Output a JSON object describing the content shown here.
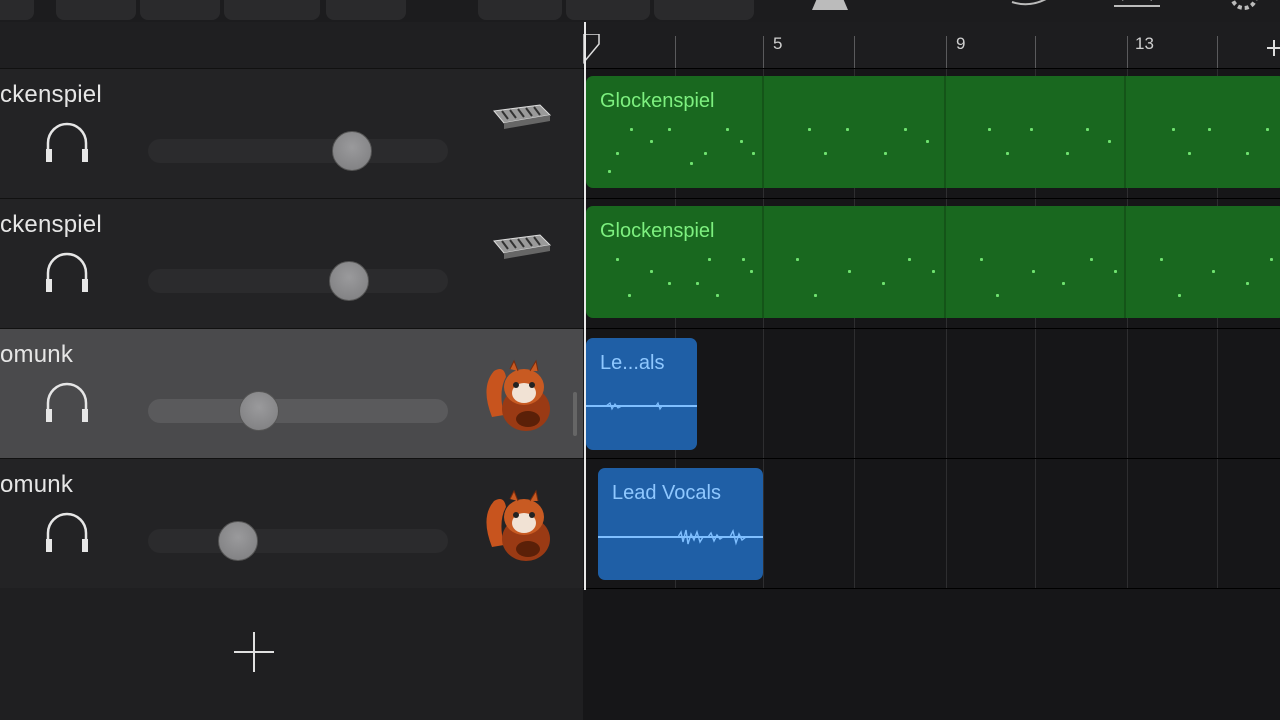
{
  "tracks": [
    {
      "name": "ckenspiel",
      "volume": 0.68,
      "instrument": "glockenspiel-icon",
      "selected": false
    },
    {
      "name": "ckenspiel",
      "volume": 0.67,
      "instrument": "glockenspiel-icon",
      "selected": false
    },
    {
      "name": "omunk",
      "volume": 0.37,
      "instrument": "chipmunk-icon",
      "selected": true
    },
    {
      "name": "omunk",
      "volume": 0.3,
      "instrument": "chipmunk-icon",
      "selected": false
    }
  ],
  "ruler": {
    "bars": [
      "5",
      "9",
      "13"
    ]
  },
  "regions": {
    "glock1": "Glockenspiel",
    "glock2": "Glockenspiel",
    "vocal1": "Le...als",
    "vocal2": "Lead Vocals"
  },
  "colors": {
    "green_region": "#19681f",
    "blue_region": "#1f5fa6",
    "record": "#ff2d2d"
  }
}
